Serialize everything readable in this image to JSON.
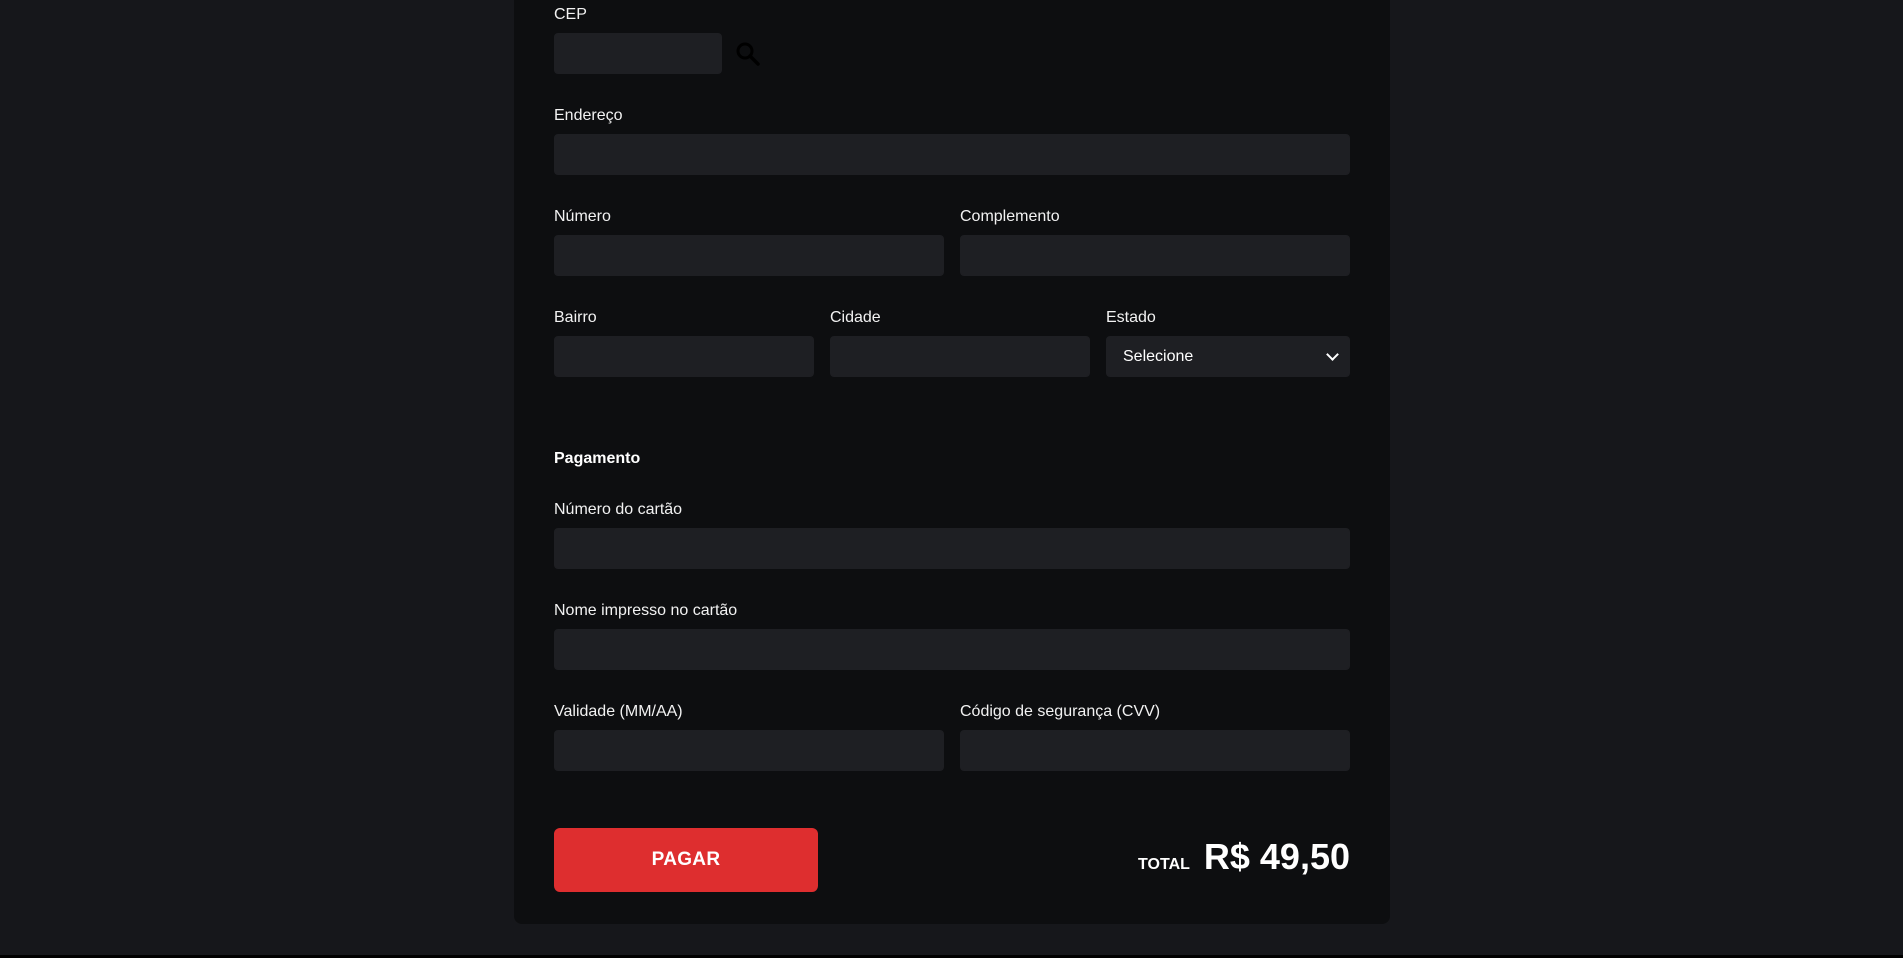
{
  "address": {
    "cep_label": "CEP",
    "cep_value": "",
    "endereco_label": "Endereço",
    "endereco_value": "",
    "numero_label": "Número",
    "numero_value": "",
    "complemento_label": "Complemento",
    "complemento_value": "",
    "bairro_label": "Bairro",
    "bairro_value": "",
    "cidade_label": "Cidade",
    "cidade_value": "",
    "estado_label": "Estado",
    "estado_selected": "Selecione"
  },
  "payment": {
    "section_title": "Pagamento",
    "card_number_label": "Número do cartão",
    "card_number_value": "",
    "card_name_label": "Nome impresso no cartão",
    "card_name_value": "",
    "validity_label": "Validade (MM/AA)",
    "validity_value": "",
    "cvv_label": "Código de segurança (CVV)",
    "cvv_value": ""
  },
  "footer": {
    "pay_button_label": "PAGAR",
    "total_label": "TOTAL",
    "total_value": "R$ 49,50"
  },
  "icons": {
    "cep_search": "search-icon",
    "estado_dropdown": "chevron-down-icon"
  },
  "colors": {
    "page_background": "#16171b",
    "card_background": "#0d0e10",
    "field_background": "#1e1f23",
    "accent": "#de2e2f"
  }
}
